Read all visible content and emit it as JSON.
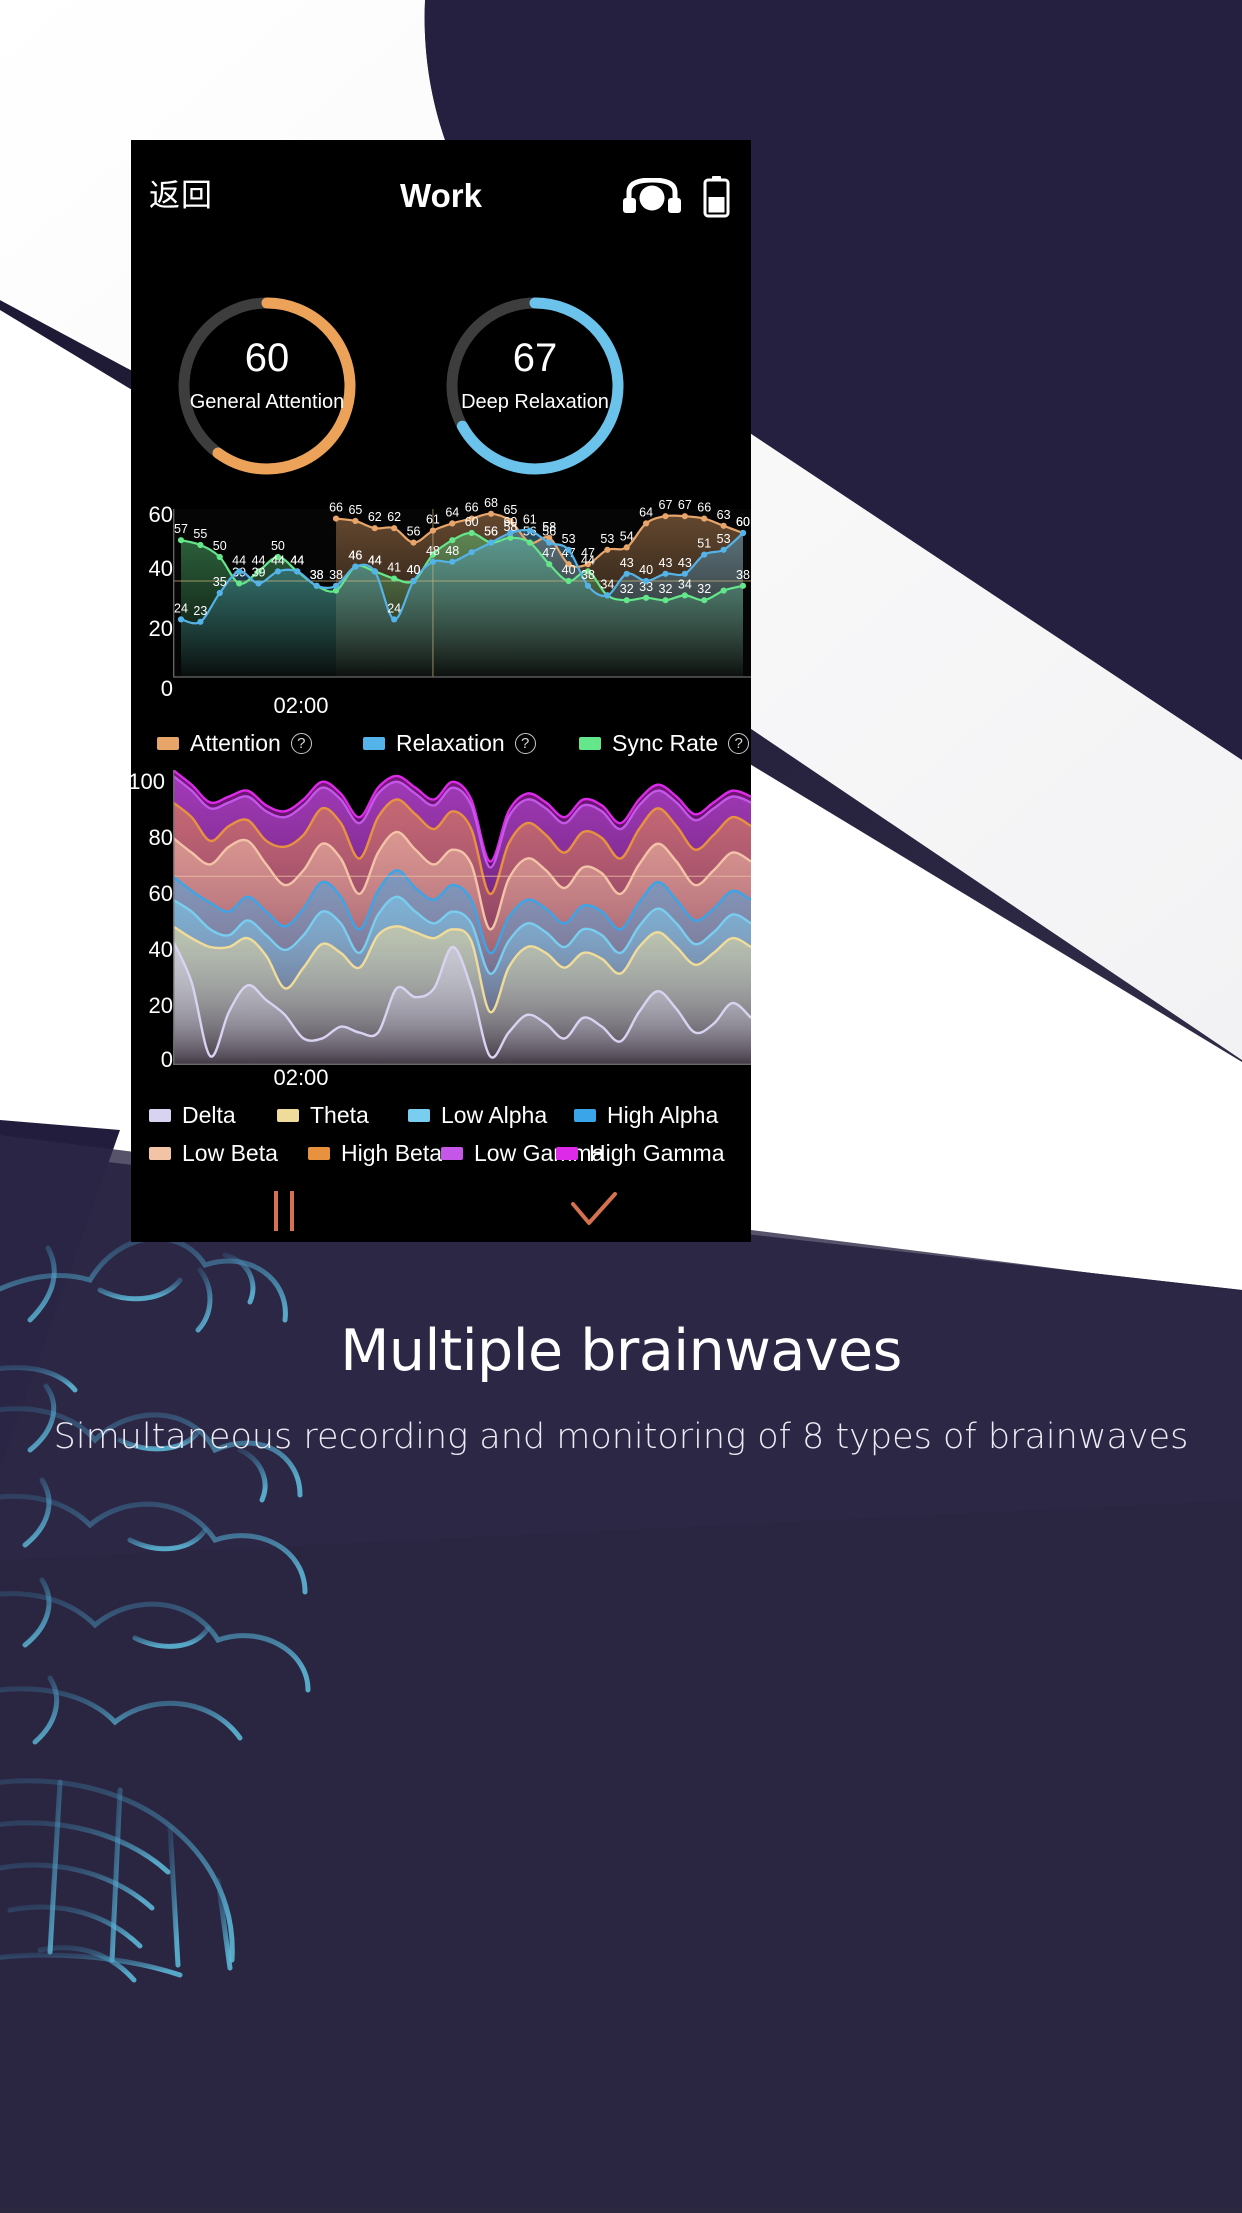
{
  "header": {
    "back_label": "返回",
    "title": "Work",
    "headset_icon": "headset-icon",
    "battery_icon": "battery-half-icon"
  },
  "gauges": [
    {
      "name": "general-attention",
      "value": "60",
      "label": "General Attention",
      "color": "#eda25a",
      "track": "#3d3d3d",
      "percent": 60
    },
    {
      "name": "deep-relaxation",
      "value": "67",
      "label": "Deep Relaxation",
      "color": "#6bc2ea",
      "track": "#3d3d3d",
      "percent": 67
    }
  ],
  "legend1": [
    {
      "label": "Attention",
      "color": "#e8a56a",
      "help": "?"
    },
    {
      "label": "Relaxation",
      "color": "#54b3e8",
      "help": "?"
    },
    {
      "label": "Sync Rate",
      "color": "#64e68a",
      "help": "?"
    }
  ],
  "legend2": [
    {
      "label": "Delta",
      "color": "#d9d3f2"
    },
    {
      "label": "Theta",
      "color": "#f0dc9a"
    },
    {
      "label": "Low Alpha",
      "color": "#79cdef"
    },
    {
      "label": "High Alpha",
      "color": "#3aa5e8"
    },
    {
      "label": "Low Beta",
      "color": "#f3c3a8"
    },
    {
      "label": "High Beta",
      "color": "#e8923f"
    },
    {
      "label": "Low Gamma",
      "color": "#c457e8"
    },
    {
      "label": "High Gamma",
      "color": "#dd2ae8"
    }
  ],
  "controls": {
    "pause_label": "pause-icon",
    "confirm_label": "check-icon",
    "accent": "#d4714f"
  },
  "caption": {
    "title": "Multiple brainwaves",
    "subtitle": "Simultaneous recording and monitoring of 8 types of brainwaves"
  },
  "chart_data": [
    {
      "type": "line",
      "title": "",
      "xlabel": "02:00",
      "ylabel": "",
      "ylim": [
        0,
        70
      ],
      "yticks": [
        "0",
        "20",
        "40",
        "60"
      ],
      "ytick_values": [
        0,
        20,
        40,
        60
      ],
      "grid": true,
      "gridline_y": 40,
      "cursor_x_index": 13,
      "legend_position": "bottom",
      "series": [
        {
          "name": "Attention",
          "color": "#e8a56a",
          "values": [
            null,
            null,
            null,
            null,
            null,
            null,
            null,
            null,
            66,
            65,
            62,
            62,
            56,
            61,
            64,
            66,
            68,
            65,
            56,
            58,
            47,
            47,
            53,
            54,
            64,
            67,
            67,
            66,
            63,
            60
          ],
          "labels": [
            "",
            "",
            "",
            "",
            "",
            "",
            "",
            "",
            "66",
            "65",
            "62",
            "62",
            "56",
            "61",
            "64",
            "66",
            "68",
            "65",
            "56",
            "58",
            "47",
            "47",
            "53",
            "54",
            "64",
            "67",
            "67",
            "66",
            "63",
            "60"
          ]
        },
        {
          "name": "Relaxation",
          "color": "#54b3e8",
          "values": [
            24,
            23,
            35,
            44,
            39,
            44,
            44,
            38,
            38,
            46,
            44,
            24,
            40,
            48,
            48,
            52,
            56,
            60,
            61,
            56,
            53,
            38,
            34,
            43,
            40,
            43,
            43,
            51,
            53,
            60
          ],
          "labels": [
            "24",
            "23",
            "35",
            "44",
            "39",
            "44",
            "44",
            "38",
            "38",
            "46",
            "44",
            "24",
            "40",
            "48",
            "48",
            "",
            "56",
            "60",
            "61",
            "56",
            "53",
            "38",
            "",
            "43",
            "40",
            "43",
            "43",
            "51",
            "53",
            "60"
          ]
        },
        {
          "name": "Sync Rate",
          "color": "#64e68a",
          "values": [
            57,
            55,
            50,
            39,
            44,
            50,
            44,
            38,
            36,
            46,
            44,
            41,
            40,
            51,
            57,
            60,
            56,
            58,
            56,
            47,
            40,
            44,
            34,
            32,
            33,
            32,
            34,
            32,
            36,
            38
          ],
          "labels": [
            "57",
            "55",
            "50",
            "39",
            "44",
            "50",
            "44",
            "38",
            "",
            "46",
            "44",
            "41",
            "40",
            "",
            "",
            "60",
            "56",
            "58",
            "",
            "47",
            "40",
            "44",
            "34",
            "32",
            "33",
            "32",
            "34",
            "32",
            "",
            "38"
          ]
        }
      ]
    },
    {
      "type": "area",
      "title": "",
      "xlabel": "02:00",
      "ylabel": "",
      "ylim": [
        0,
        100
      ],
      "yticks": [
        "0",
        "20",
        "40",
        "60",
        "80",
        "100"
      ],
      "ytick_values": [
        0,
        20,
        40,
        60,
        80,
        100
      ],
      "grid": true,
      "gridline_y": 64,
      "stacked": true,
      "legend_position": "bottom",
      "series": [
        {
          "name": "Delta",
          "color": "#d9d3f2",
          "values": [
            42,
            28,
            3,
            18,
            27,
            22,
            17,
            9,
            9,
            13,
            11,
            11,
            26,
            23,
            26,
            40,
            26,
            3,
            11,
            17,
            14,
            9,
            16,
            13,
            8,
            18,
            25,
            19,
            11,
            14,
            21,
            16
          ]
        },
        {
          "name": "Theta",
          "color": "#f0dc9a",
          "values": [
            47,
            43,
            40,
            40,
            43,
            37,
            26,
            33,
            41,
            38,
            33,
            44,
            47,
            45,
            43,
            46,
            42,
            18,
            33,
            40,
            38,
            33,
            38,
            36,
            31,
            40,
            45,
            40,
            34,
            38,
            43,
            40
          ]
        },
        {
          "name": "Low Alpha",
          "color": "#79cdef",
          "values": [
            56,
            52,
            46,
            44,
            49,
            44,
            39,
            44,
            52,
            48,
            38,
            51,
            57,
            52,
            48,
            52,
            48,
            31,
            42,
            48,
            45,
            40,
            46,
            44,
            38,
            47,
            53,
            48,
            41,
            45,
            51,
            48
          ]
        },
        {
          "name": "High Alpha",
          "color": "#3aa5e8",
          "values": [
            64,
            59,
            55,
            52,
            57,
            52,
            47,
            53,
            62,
            57,
            46,
            59,
            66,
            60,
            56,
            61,
            56,
            38,
            50,
            56,
            53,
            48,
            54,
            52,
            46,
            55,
            62,
            56,
            49,
            53,
            59,
            56
          ]
        },
        {
          "name": "Low Beta",
          "color": "#f3c3a8",
          "values": [
            77,
            72,
            68,
            74,
            76,
            68,
            61,
            66,
            75,
            70,
            58,
            72,
            79,
            73,
            68,
            73,
            68,
            46,
            63,
            70,
            66,
            60,
            67,
            65,
            58,
            68,
            75,
            69,
            61,
            66,
            72,
            69
          ]
        },
        {
          "name": "High Beta",
          "color": "#e8923f",
          "values": [
            89,
            84,
            76,
            81,
            83,
            76,
            74,
            78,
            87,
            82,
            70,
            84,
            90,
            85,
            80,
            86,
            80,
            58,
            75,
            82,
            78,
            72,
            79,
            77,
            70,
            80,
            87,
            81,
            73,
            78,
            84,
            81
          ]
        },
        {
          "name": "Low Gamma",
          "color": "#c457e8",
          "values": [
            98,
            93,
            87,
            89,
            91,
            86,
            84,
            88,
            94,
            90,
            82,
            92,
            96,
            92,
            88,
            94,
            88,
            67,
            84,
            90,
            87,
            82,
            88,
            86,
            80,
            88,
            93,
            89,
            83,
            87,
            91,
            89
          ]
        },
        {
          "name": "High Gamma",
          "color": "#dd2ae8",
          "values": [
            100,
            95,
            89,
            91,
            93,
            88,
            86,
            90,
            96,
            92,
            84,
            94,
            98,
            94,
            90,
            96,
            90,
            69,
            86,
            92,
            89,
            84,
            90,
            88,
            82,
            90,
            95,
            91,
            85,
            89,
            93,
            91
          ]
        }
      ]
    }
  ]
}
